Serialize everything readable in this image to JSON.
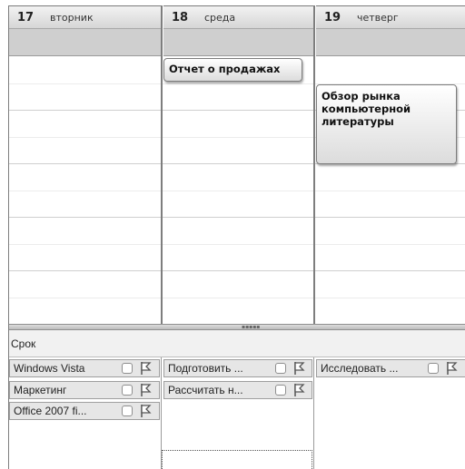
{
  "days": [
    {
      "number": "17",
      "name": "вторник"
    },
    {
      "number": "18",
      "name": "среда"
    },
    {
      "number": "19",
      "name": "четверг"
    }
  ],
  "appointments": [
    {
      "title": "Отчет о продажах"
    },
    {
      "title": "Обзор рынка компьютерной литературы"
    }
  ],
  "tasks_header": "Срок",
  "tasks": [
    {
      "label": "Windows Vista"
    },
    {
      "label": "Маркетинг"
    },
    {
      "label": "Office 2007 fi..."
    },
    {
      "label": "Подготовить ..."
    },
    {
      "label": "Рассчитать н..."
    },
    {
      "label": "Исследовать ..."
    }
  ],
  "colors": {
    "header_bg": "#d6d6d6",
    "allday_bg": "#cfcfcf",
    "task_bg": "#e6e6e6"
  },
  "icons": [
    "checkbox-icon",
    "flag-icon"
  ]
}
